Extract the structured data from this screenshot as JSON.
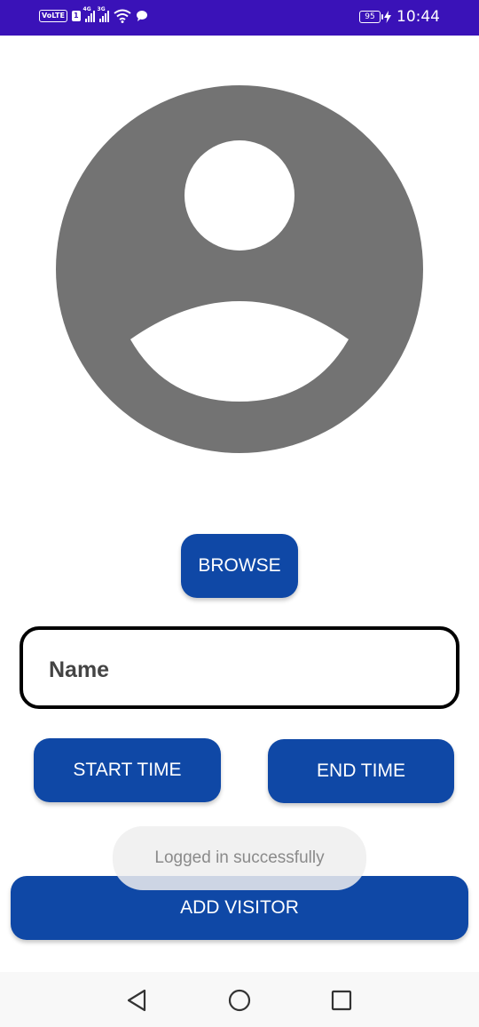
{
  "status_bar": {
    "volte": "VoLTE",
    "sim": "1",
    "network_1": "4G",
    "network_2": "3G",
    "battery": "95",
    "time": "10:44"
  },
  "avatar": {
    "icon": "account-circle-icon"
  },
  "browse_label": "BROWSE",
  "name_field": {
    "placeholder": "Name",
    "value": ""
  },
  "start_time_label": "START TIME",
  "end_time_label": "END TIME",
  "toast": "Logged in successfully",
  "add_visitor_label": "ADD VISITOR",
  "nav": {
    "back": "back-triangle-icon",
    "home": "home-circle-icon",
    "recents": "recents-square-icon"
  },
  "colors": {
    "status_bar": "#3a12b8",
    "accent": "#0f48a6",
    "avatar": "#737373"
  }
}
